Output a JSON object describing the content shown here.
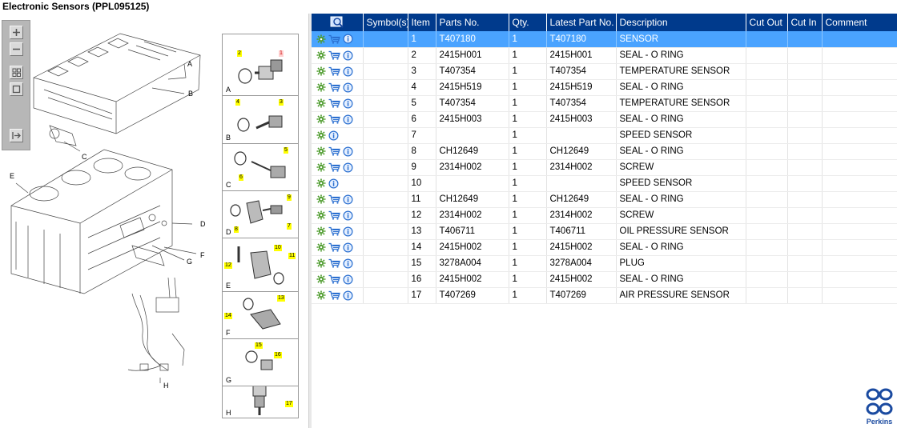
{
  "window": {
    "title": "Electronic Sensors (PPL095125)"
  },
  "zoom_toolbar": {
    "buttons": [
      "zoom-in",
      "zoom-out",
      "fit-all",
      "fit-window",
      "export"
    ]
  },
  "diagram": {
    "callouts": [
      "A",
      "B",
      "C",
      "D",
      "E",
      "F",
      "G",
      "H"
    ]
  },
  "thumbnails": [
    {
      "letter": "A",
      "items": [
        "2",
        "1"
      ]
    },
    {
      "letter": "B",
      "items": [
        "4",
        "3"
      ]
    },
    {
      "letter": "C",
      "items": [
        "5",
        "6"
      ]
    },
    {
      "letter": "D",
      "items": [
        "9",
        "8",
        "7"
      ]
    },
    {
      "letter": "E",
      "items": [
        "10",
        "11",
        "12"
      ]
    },
    {
      "letter": "F",
      "items": [
        "13",
        "14"
      ]
    },
    {
      "letter": "G",
      "items": [
        "15",
        "16"
      ]
    },
    {
      "letter": "H",
      "items": [
        "17"
      ]
    }
  ],
  "table": {
    "columns": [
      "",
      "Symbol(s)",
      "Item",
      "Parts No.",
      "Qty.",
      "Latest Part No.",
      "Description",
      "Cut Out",
      "Cut In",
      "Comment"
    ],
    "selected_row": 0,
    "rows": [
      {
        "cart": true,
        "symbol": "",
        "item": "1",
        "part": "T407180",
        "qty": "1",
        "latest": "T407180",
        "desc": "SENSOR",
        "cut_out": "",
        "cut_in": "",
        "comment": ""
      },
      {
        "cart": true,
        "symbol": "",
        "item": "2",
        "part": "2415H001",
        "qty": "1",
        "latest": "2415H001",
        "desc": "SEAL - O RING",
        "cut_out": "",
        "cut_in": "",
        "comment": ""
      },
      {
        "cart": true,
        "symbol": "",
        "item": "3",
        "part": "T407354",
        "qty": "1",
        "latest": "T407354",
        "desc": "TEMPERATURE SENSOR",
        "cut_out": "",
        "cut_in": "",
        "comment": ""
      },
      {
        "cart": true,
        "symbol": "",
        "item": "4",
        "part": "2415H519",
        "qty": "1",
        "latest": "2415H519",
        "desc": "SEAL - O RING",
        "cut_out": "",
        "cut_in": "",
        "comment": ""
      },
      {
        "cart": true,
        "symbol": "",
        "item": "5",
        "part": "T407354",
        "qty": "1",
        "latest": "T407354",
        "desc": "TEMPERATURE SENSOR",
        "cut_out": "",
        "cut_in": "",
        "comment": ""
      },
      {
        "cart": true,
        "symbol": "",
        "item": "6",
        "part": "2415H003",
        "qty": "1",
        "latest": "2415H003",
        "desc": "SEAL - O RING",
        "cut_out": "",
        "cut_in": "",
        "comment": ""
      },
      {
        "cart": false,
        "symbol": "",
        "item": "7",
        "part": "",
        "qty": "1",
        "latest": "",
        "desc": "SPEED SENSOR",
        "cut_out": "",
        "cut_in": "",
        "comment": ""
      },
      {
        "cart": true,
        "symbol": "",
        "item": "8",
        "part": "CH12649",
        "qty": "1",
        "latest": "CH12649",
        "desc": "SEAL - O RING",
        "cut_out": "",
        "cut_in": "",
        "comment": ""
      },
      {
        "cart": true,
        "symbol": "",
        "item": "9",
        "part": "2314H002",
        "qty": "1",
        "latest": "2314H002",
        "desc": "SCREW",
        "cut_out": "",
        "cut_in": "",
        "comment": ""
      },
      {
        "cart": false,
        "symbol": "",
        "item": "10",
        "part": "",
        "qty": "1",
        "latest": "",
        "desc": "SPEED SENSOR",
        "cut_out": "",
        "cut_in": "",
        "comment": ""
      },
      {
        "cart": true,
        "symbol": "",
        "item": "11",
        "part": "CH12649",
        "qty": "1",
        "latest": "CH12649",
        "desc": "SEAL - O RING",
        "cut_out": "",
        "cut_in": "",
        "comment": ""
      },
      {
        "cart": true,
        "symbol": "",
        "item": "12",
        "part": "2314H002",
        "qty": "1",
        "latest": "2314H002",
        "desc": "SCREW",
        "cut_out": "",
        "cut_in": "",
        "comment": ""
      },
      {
        "cart": true,
        "symbol": "",
        "item": "13",
        "part": "T406711",
        "qty": "1",
        "latest": "T406711",
        "desc": "OIL PRESSURE SENSOR",
        "cut_out": "",
        "cut_in": "",
        "comment": ""
      },
      {
        "cart": true,
        "symbol": "",
        "item": "14",
        "part": "2415H002",
        "qty": "1",
        "latest": "2415H002",
        "desc": "SEAL - O RING",
        "cut_out": "",
        "cut_in": "",
        "comment": ""
      },
      {
        "cart": true,
        "symbol": "",
        "item": "15",
        "part": "3278A004",
        "qty": "1",
        "latest": "3278A004",
        "desc": "PLUG",
        "cut_out": "",
        "cut_in": "",
        "comment": ""
      },
      {
        "cart": true,
        "symbol": "",
        "item": "16",
        "part": "2415H002",
        "qty": "1",
        "latest": "2415H002",
        "desc": "SEAL - O RING",
        "cut_out": "",
        "cut_in": "",
        "comment": ""
      },
      {
        "cart": true,
        "symbol": "",
        "item": "17",
        "part": "T407269",
        "qty": "1",
        "latest": "T407269",
        "desc": "AIR PRESSURE SENSOR",
        "cut_out": "",
        "cut_in": "",
        "comment": ""
      }
    ]
  },
  "brand": {
    "name": "Perkins"
  },
  "colors": {
    "header": "#003a8c",
    "selected_row": "#4aa3ff",
    "gear": "#4b9a2a",
    "info": "#2a6fd0",
    "cart": "#2a6fd0"
  }
}
